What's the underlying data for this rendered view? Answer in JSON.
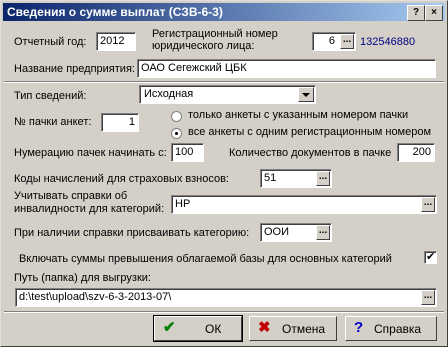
{
  "window": {
    "title": "Сведения о сумме выплат (СЗВ-6-3)"
  },
  "report_year": {
    "label": "Отчетный год:",
    "value": "2012"
  },
  "reg_number": {
    "label_line1": "Регистрационный номер",
    "label_line2": "юридического лица:",
    "value": "6",
    "number": "132546880"
  },
  "company": {
    "label": "Название предприятия:",
    "value": "ОАО Сегежский ЦБК"
  },
  "info_type": {
    "label": "Тип сведений:",
    "value": "Исходная"
  },
  "pack": {
    "label": "№ пачки анкет:",
    "value": "1",
    "radio_only": "только анкеты с указанным номером пачки",
    "radio_all": "все анкеты с одним регистрационным номером",
    "selected": "all"
  },
  "numbering": {
    "label": "Нумерацию пачек начинать с:",
    "value": "100"
  },
  "doc_count": {
    "label": "Количество документов в пачке",
    "value": "200"
  },
  "contrib_codes": {
    "label": "Коды начислений для страховых взносов:",
    "value": "51"
  },
  "disability": {
    "label_line1": "Учитывать справки об",
    "label_line2": "инвалидности для категорий:",
    "value": "НР"
  },
  "assign_category": {
    "label": "При наличии справки присваивать категорию:",
    "value": "ООИ"
  },
  "include_excess": {
    "label": "Включать суммы превышения облагаемой базы для основных категорий",
    "checked": true
  },
  "export_path": {
    "label": "Путь (папка) для выгрузки:",
    "value": "d:\\test\\upload\\szv-6-3-2013-07\\"
  },
  "buttons": {
    "ok": "ОК",
    "cancel": "Отмена",
    "help": "Справка"
  },
  "title_buttons": {
    "help": "?",
    "close": "×"
  },
  "ellipsis": "..."
}
